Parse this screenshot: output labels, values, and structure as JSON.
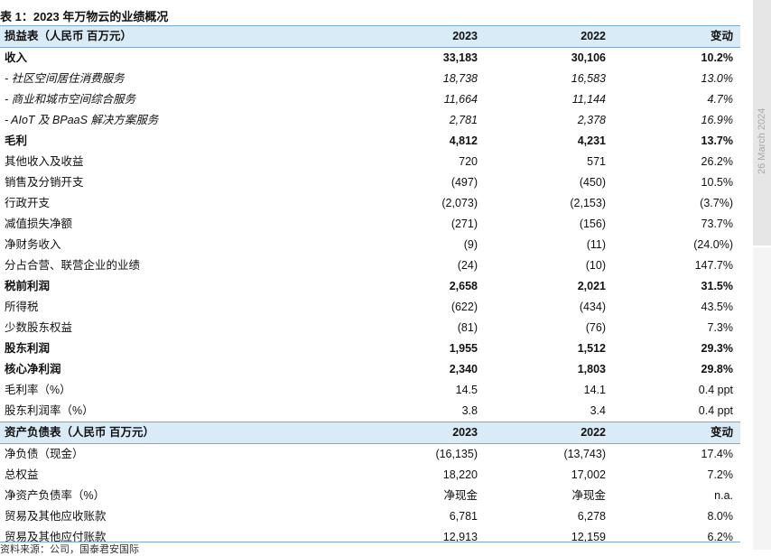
{
  "title": "表 1：2023 年万物云的业绩概况",
  "side_date": "26 March 2024",
  "source_text": "资料来源：公司，国泰君安国际",
  "income": {
    "header": [
      "损益表（人民币 百万元）",
      "2023",
      "2022",
      "变动"
    ],
    "rows": [
      {
        "label": "收入",
        "v2023": "33,183",
        "v2022": "30,106",
        "chg": "10.2%",
        "style": "bold"
      },
      {
        "label": "- 社区空间居住消费服务",
        "v2023": "18,738",
        "v2022": "16,583",
        "chg": "13.0%",
        "style": "ital"
      },
      {
        "label": "- 商业和城市空间综合服务",
        "v2023": "11,664",
        "v2022": "11,144",
        "chg": "4.7%",
        "style": "ital"
      },
      {
        "label": "- AIoT 及 BPaaS 解决方案服务",
        "v2023": "2,781",
        "v2022": "2,378",
        "chg": "16.9%",
        "style": "ital"
      },
      {
        "label": "毛利",
        "v2023": "4,812",
        "v2022": "4,231",
        "chg": "13.7%",
        "style": "bold"
      },
      {
        "label": "其他收入及收益",
        "v2023": "720",
        "v2022": "571",
        "chg": "26.2%",
        "style": ""
      },
      {
        "label": "销售及分销开支",
        "v2023": "(497)",
        "v2022": "(450)",
        "chg": "10.5%",
        "style": ""
      },
      {
        "label": "行政开支",
        "v2023": "(2,073)",
        "v2022": "(2,153)",
        "chg": "(3.7%)",
        "style": ""
      },
      {
        "label": "减值损失净额",
        "v2023": "(271)",
        "v2022": "(156)",
        "chg": "73.7%",
        "style": ""
      },
      {
        "label": "净财务收入",
        "v2023": "(9)",
        "v2022": "(11)",
        "chg": "(24.0%)",
        "style": ""
      },
      {
        "label": "分占合营、联营企业的业绩",
        "v2023": "(24)",
        "v2022": "(10)",
        "chg": "147.7%",
        "style": ""
      },
      {
        "label": "税前利润",
        "v2023": "2,658",
        "v2022": "2,021",
        "chg": "31.5%",
        "style": "bold"
      },
      {
        "label": "所得税",
        "v2023": "(622)",
        "v2022": "(434)",
        "chg": "43.5%",
        "style": ""
      },
      {
        "label": "少数股东权益",
        "v2023": "(81)",
        "v2022": "(76)",
        "chg": "7.3%",
        "style": ""
      },
      {
        "label": "股东利润",
        "v2023": "1,955",
        "v2022": "1,512",
        "chg": "29.3%",
        "style": "bold"
      },
      {
        "label": "核心净利润",
        "v2023": "2,340",
        "v2022": "1,803",
        "chg": "29.8%",
        "style": "bold"
      },
      {
        "label": "毛利率（%）",
        "v2023": "14.5",
        "v2022": "14.1",
        "chg": "0.4 ppt",
        "style": ""
      },
      {
        "label": "股东利润率（%）",
        "v2023": "3.8",
        "v2022": "3.4",
        "chg": "0.4 ppt",
        "style": ""
      }
    ]
  },
  "balance": {
    "header": [
      "资产负债表（人民币 百万元）",
      "2023",
      "2022",
      "变动"
    ],
    "rows": [
      {
        "label": "净负债（现金）",
        "v2023": "(16,135)",
        "v2022": "(13,743)",
        "chg": "17.4%",
        "style": ""
      },
      {
        "label": "总权益",
        "v2023": "18,220",
        "v2022": "17,002",
        "chg": "7.2%",
        "style": ""
      },
      {
        "label": "净资产负债率（%）",
        "v2023": "净现金",
        "v2022": "净现金",
        "chg": "n.a.",
        "style": ""
      },
      {
        "label": "贸易及其他应收账款",
        "v2023": "6,781",
        "v2022": "6,278",
        "chg": "8.0%",
        "style": ""
      },
      {
        "label": "贸易及其他应付账款",
        "v2023": "12,913",
        "v2022": "12,159",
        "chg": "6.2%",
        "style": ""
      }
    ]
  }
}
